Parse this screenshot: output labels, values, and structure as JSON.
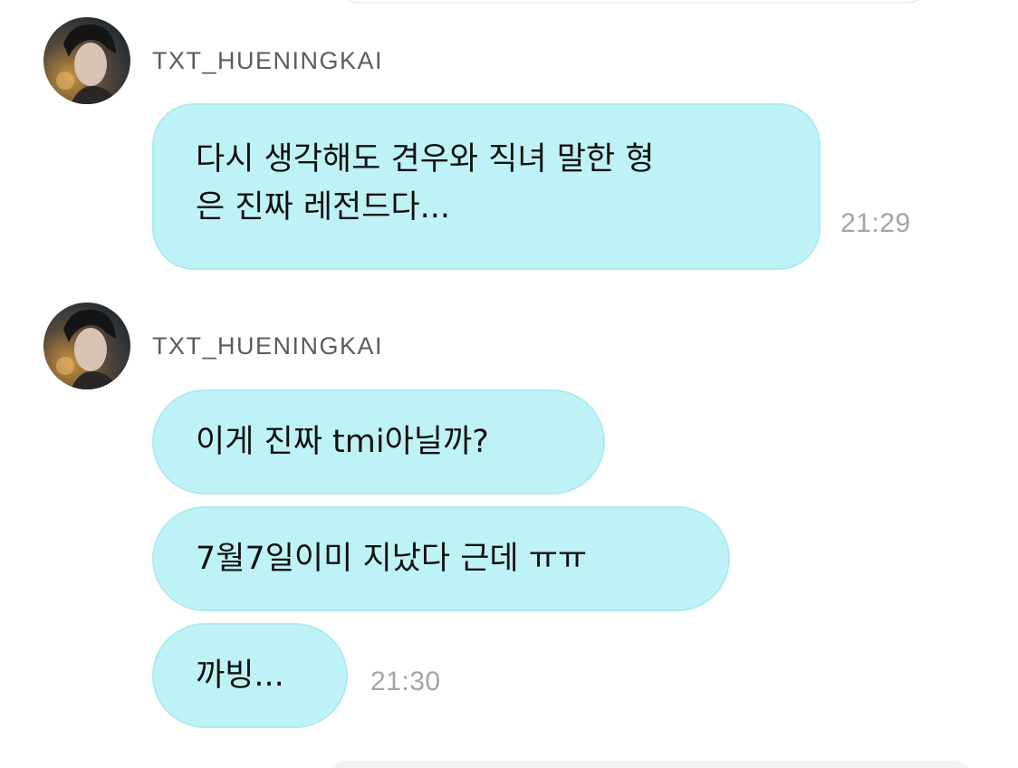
{
  "groups": [
    {
      "sender": "TXT_HUENINGKAI",
      "messages": [
        {
          "lines": [
            "다시 생각해도 견우와 직녀 말한 형",
            "은 진짜 레전드다..."
          ]
        }
      ],
      "time": "21:29"
    },
    {
      "sender": "TXT_HUENINGKAI",
      "messages": [
        {
          "lines": [
            "이게 진짜 tmi아닐까?"
          ]
        },
        {
          "lines": [
            "7월7일이미 지났다 근데 ㅠㅠ"
          ]
        },
        {
          "lines": [
            "까빙..."
          ]
        }
      ],
      "time": "21:30"
    }
  ],
  "colors": {
    "bubble": "#bff2f6",
    "bubble_border": "#aeeaf0",
    "timestamp": "#a5a5a5",
    "sender": "#5c5c5c"
  },
  "icons": {
    "avatar": "profile-photo"
  }
}
